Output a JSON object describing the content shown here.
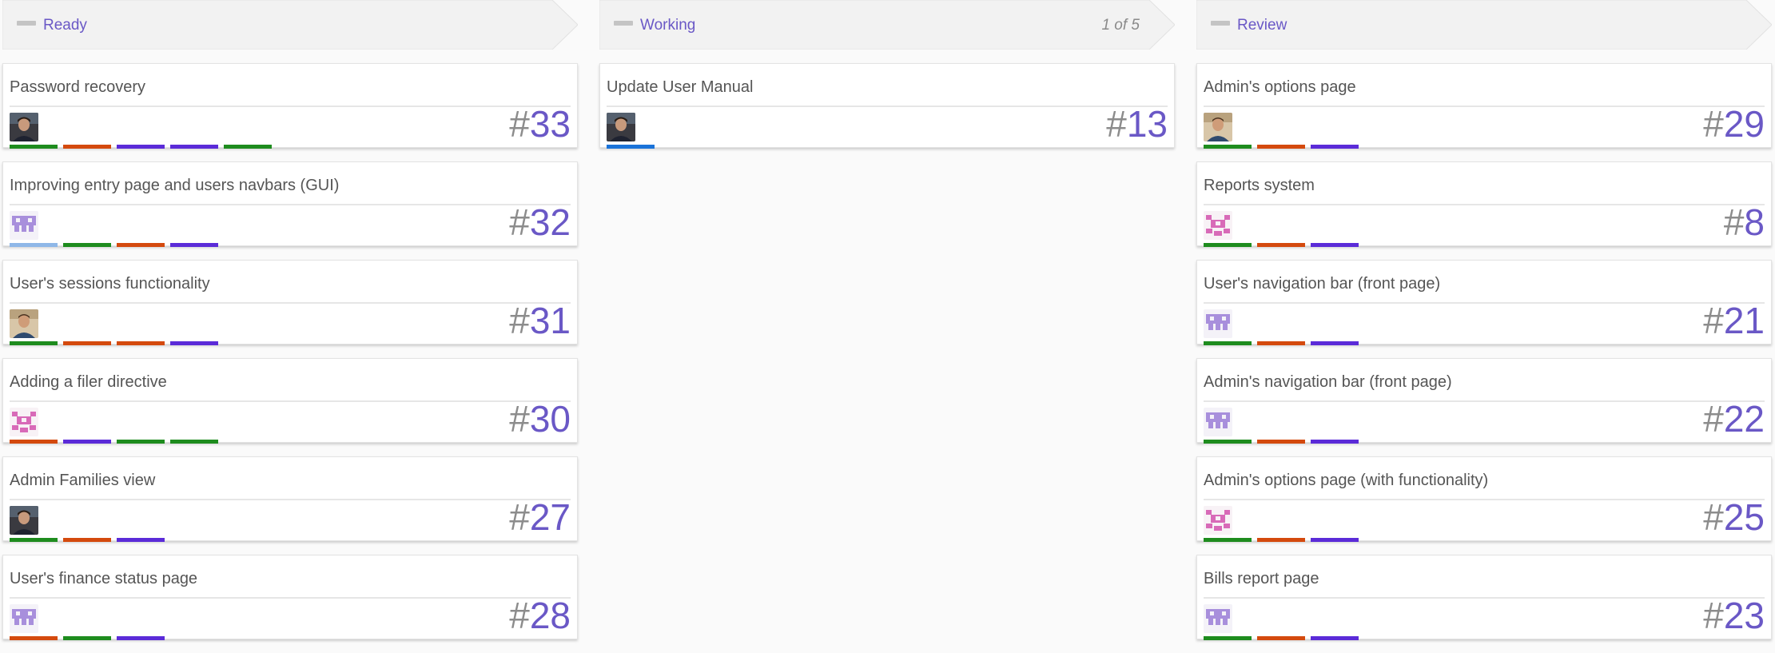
{
  "colors": {
    "accent": "#6a58c6",
    "green": "#1e8c1e",
    "orange": "#d44a0e",
    "purple": "#5b2bd8",
    "blue": "#1a73d9",
    "lightblue": "#8fb8e8"
  },
  "columns": [
    {
      "title": "Ready",
      "count": "",
      "cards": [
        {
          "title": "Password recovery",
          "number": "33",
          "avatar": "photo-a",
          "labels": [
            "green",
            "orange",
            "purple",
            "purple",
            "green"
          ]
        },
        {
          "title": "Improving entry page and users navbars (GUI)",
          "number": "32",
          "avatar": "identicon-purple",
          "labels": [
            "lightblue",
            "green",
            "orange",
            "purple"
          ]
        },
        {
          "title": "User's sessions functionality",
          "number": "31",
          "avatar": "photo-b",
          "labels": [
            "green",
            "orange",
            "orange",
            "purple"
          ]
        },
        {
          "title": "Adding a filer directive",
          "number": "30",
          "avatar": "identicon-pink",
          "labels": [
            "orange",
            "purple",
            "green",
            "green"
          ]
        },
        {
          "title": "Admin Families view",
          "number": "27",
          "avatar": "photo-a",
          "labels": [
            "green",
            "orange",
            "purple"
          ]
        },
        {
          "title": "User's finance status page",
          "number": "28",
          "avatar": "identicon-purple",
          "labels": [
            "orange",
            "green",
            "purple"
          ]
        }
      ]
    },
    {
      "title": "Working",
      "count": "1 of 5",
      "cards": [
        {
          "title": "Update User Manual",
          "number": "13",
          "avatar": "photo-a",
          "labels": [
            "blue"
          ]
        }
      ]
    },
    {
      "title": "Review",
      "count": "",
      "cards": [
        {
          "title": "Admin's options page",
          "number": "29",
          "avatar": "photo-b",
          "labels": [
            "green",
            "orange",
            "purple"
          ]
        },
        {
          "title": "Reports system",
          "number": "8",
          "avatar": "identicon-pink",
          "labels": [
            "green",
            "orange",
            "purple"
          ]
        },
        {
          "title": "User's navigation bar (front page)",
          "number": "21",
          "avatar": "identicon-purple",
          "labels": [
            "green",
            "orange",
            "purple"
          ]
        },
        {
          "title": "Admin's navigation bar (front page)",
          "number": "22",
          "avatar": "identicon-purple",
          "labels": [
            "green",
            "orange",
            "purple"
          ]
        },
        {
          "title": "Admin's options page (with functionality)",
          "number": "25",
          "avatar": "identicon-pink",
          "labels": [
            "green",
            "orange",
            "purple"
          ]
        },
        {
          "title": "Bills report page",
          "number": "23",
          "avatar": "identicon-purple",
          "labels": [
            "green",
            "orange",
            "purple"
          ]
        }
      ]
    }
  ]
}
